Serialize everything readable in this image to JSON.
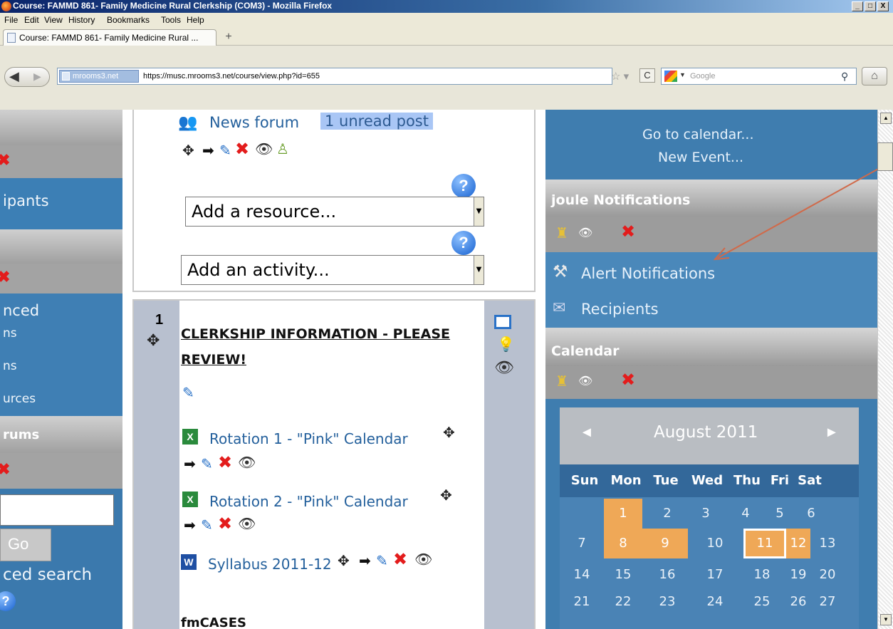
{
  "window": {
    "title": "Course: FAMMD 861- Family Medicine Rural Clerkship (COM3) - Mozilla Firefox",
    "controls": [
      "_",
      "□",
      "X"
    ]
  },
  "menu": [
    "File",
    "Edit",
    "View",
    "History",
    "Bookmarks",
    "Tools",
    "Help"
  ],
  "tab": {
    "title": "Course: FAMMD 861- Family Medicine Rural ...",
    "new_tab": "+"
  },
  "nav": {
    "site_identity": "mrooms3.net",
    "url": "https://musc.mrooms3.net/course/view.php?id=655",
    "search_placeholder": "Google"
  },
  "left": {
    "participants_fragment": "ipants",
    "advanced_fragment": "nced",
    "ns1": "ns",
    "ns2": "ns",
    "urces": "urces",
    "forums_fragment": "rums",
    "search_go": "Go",
    "advanced_search_fragment": "ced search",
    "help": "?"
  },
  "middle": {
    "news_forum": "News forum",
    "unread": "1 unread post",
    "add_resource": "Add a resource...",
    "add_activity": "Add an activity...",
    "help": "?",
    "section_number": "1",
    "section_title_1": "CLERKSHIP INFORMATION - PLEASE",
    "section_title_2": "REVIEW!",
    "items": [
      {
        "label": "Rotation 1 - \"Pink\" Calendar"
      },
      {
        "label": "Rotation 2 - \"Pink\" Calendar"
      },
      {
        "label": "Syllabus 2011-12"
      }
    ],
    "fmcases": "fmCASES"
  },
  "right": {
    "go_calendar": "Go to calendar...",
    "new_event": "New Event...",
    "joule_title": "joule Notifications",
    "alert_notifications": "Alert Notifications",
    "recipients": "Recipients",
    "calendar_title": "Calendar",
    "calendar": {
      "month": "August 2011",
      "prev": "◄",
      "next": "►",
      "days": [
        "Sun",
        "Mon",
        "Tue",
        "Wed",
        "Thu",
        "Fri",
        "Sat"
      ],
      "week1": [
        "",
        "1",
        "2",
        "3",
        "4",
        "5",
        "6"
      ],
      "week2": [
        "7",
        "8",
        "9",
        "10",
        "11",
        "12",
        "13"
      ],
      "week3": [
        "14",
        "15",
        "16",
        "17",
        "18",
        "19",
        "20"
      ],
      "week4": [
        "21",
        "22",
        "23",
        "24",
        "25",
        "26",
        "27"
      ]
    }
  },
  "colors": {
    "right_blue": "#3f7daf",
    "highlight_orange": "#efa857",
    "link_blue": "#24609c",
    "unread_bg": "#a9c6f5",
    "delete_red": "#e31c1c",
    "annotation_arrow": "#d06a4a"
  }
}
